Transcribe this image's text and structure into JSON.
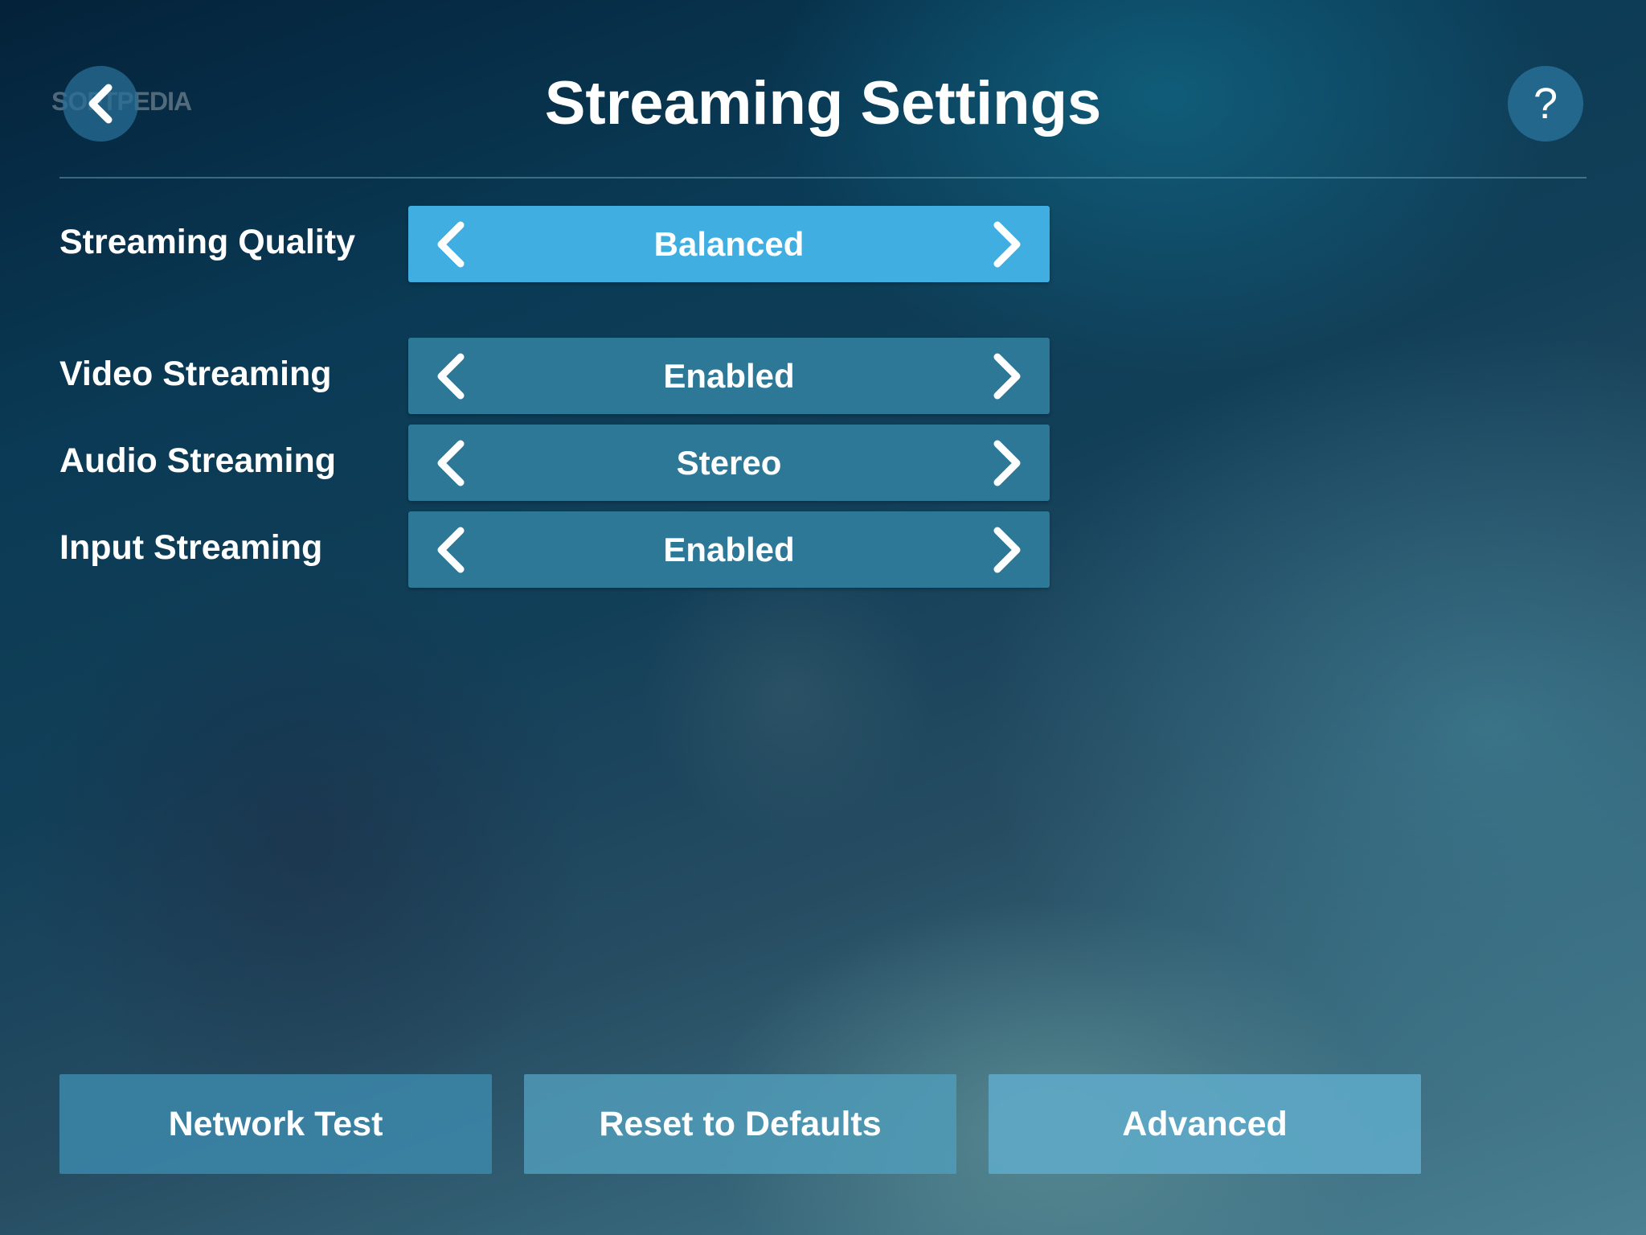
{
  "watermark": "SOFTPEDIA",
  "header": {
    "title": "Streaming Settings",
    "help_label": "?"
  },
  "settings": [
    {
      "label": "Streaming Quality",
      "value": "Balanced"
    },
    {
      "label": "Video Streaming",
      "value": "Enabled"
    },
    {
      "label": "Audio Streaming",
      "value": "Stereo"
    },
    {
      "label": "Input Streaming",
      "value": "Enabled"
    }
  ],
  "buttons": {
    "network_test": "Network Test",
    "reset_defaults": "Reset to Defaults",
    "advanced": "Advanced"
  },
  "colors": {
    "selector_active": "#41aee1",
    "selector_default": "#2e7897"
  },
  "icons": {
    "back": "chevron-left-icon",
    "help": "question-mark-icon",
    "previous_option": "chevron-left-icon",
    "next_option": "chevron-right-icon"
  }
}
